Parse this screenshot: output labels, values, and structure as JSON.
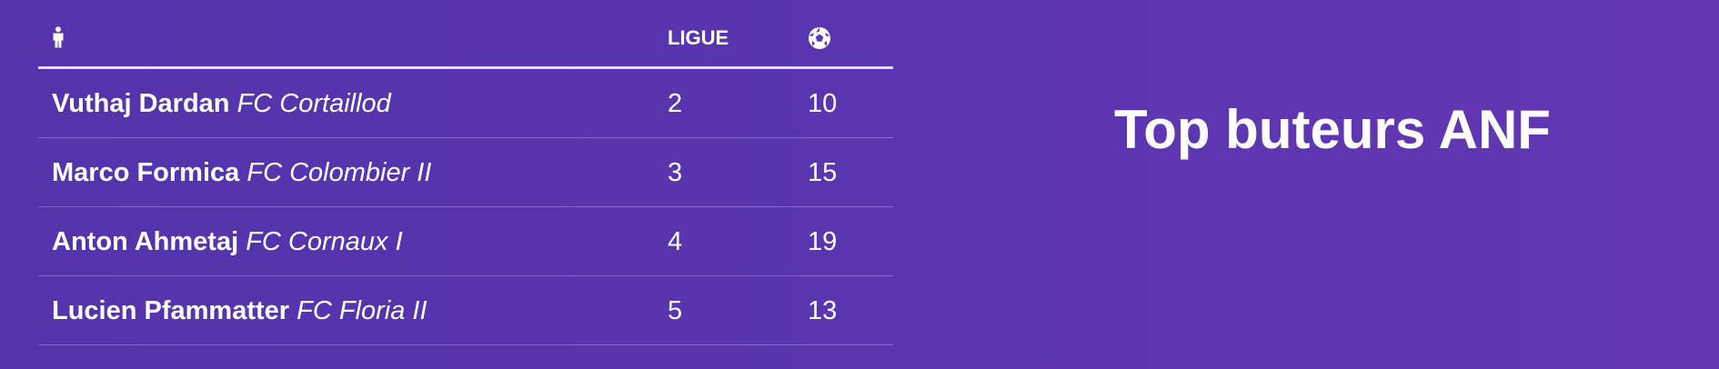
{
  "table": {
    "header": {
      "player_icon": "person-icon",
      "league": "LIGUE",
      "goals_icon": "soccer-ball-icon"
    },
    "rows": [
      {
        "name": "Vuthaj Dardan",
        "club": "FC Cortaillod",
        "league": "2",
        "goals": "10"
      },
      {
        "name": "Marco Formica",
        "club": "FC Colombier II",
        "league": "3",
        "goals": "15"
      },
      {
        "name": "Anton Ahmetaj",
        "club": "FC Cornaux I",
        "league": "4",
        "goals": "19"
      },
      {
        "name": "Lucien Pfammatter",
        "club": "FC Floria II",
        "league": "5",
        "goals": "13"
      }
    ]
  },
  "title": "Top buteurs ANF",
  "colors": {
    "background": "#5935b0",
    "text": "#ffffff",
    "header_rule": "#e6dff5"
  }
}
